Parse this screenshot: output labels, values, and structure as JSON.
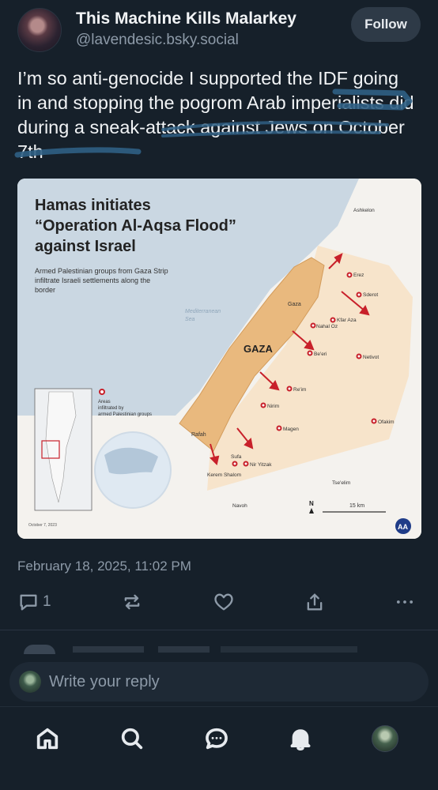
{
  "author": {
    "display_name": "This Machine Kills Malarkey",
    "handle": "@lavendesic.bsky.social",
    "avatar": "profile-avatar"
  },
  "follow_label": "Follow",
  "post": {
    "text": "I’m so anti-genocide I supported the IDF going in and stopping the pogrom Arab imperialists did during a sneak-attack against Jews on October 7th",
    "timestamp": "February 18, 2025, 11:02 PM"
  },
  "image": {
    "title_line1": "Hamas initiates",
    "title_line2": "“Operation Al-Aqsa Flood”",
    "title_line3": "against Israel",
    "subtitle_line1": "Armed Palestinian groups from Gaza Strip",
    "subtitle_line2": "infiltrate Israeli settlements along the",
    "subtitle_line3": "border",
    "sea_line1": "Mediterranean",
    "sea_line2": "Sea",
    "gaza_label": "GAZA",
    "gaza_city": "Gaza",
    "rafah": "Rafah",
    "legend_line1": "Areas",
    "legend_line2": "infiltrated by",
    "legend_line3": "armed Palestinian groups",
    "places": {
      "ashkelon": "Ashkelon",
      "erez": "Erez",
      "sderot": "Sderot",
      "kfar_aza": "Kfar Aza",
      "nahal_oz": "Nahal Oz",
      "beeri": "Be'eri",
      "netivot": "Netivot",
      "reim": "Re'im",
      "nirim": "Nirim",
      "ofakim": "Ofakim",
      "magen": "Magen",
      "sufa": "Sufa",
      "nir_yitzak": "Nir Yitzak",
      "kerem_shalom": "Kerem Shalom",
      "tseelim": "Tse'elim",
      "navoh": "Navoh"
    },
    "north": "N",
    "scale": "15 km",
    "date": "October 7, 2023",
    "agency_logo": "AA"
  },
  "actions": {
    "reply_count": "1",
    "reply_icon": "reply-icon",
    "repost_icon": "repost-icon",
    "like_icon": "heart-icon",
    "share_icon": "share-icon",
    "more_icon": "more-icon"
  },
  "reply_bar": {
    "placeholder": "Write your reply"
  },
  "nav": {
    "home": "home-icon",
    "search": "search-icon",
    "chat": "chat-icon",
    "notifications": "bell-icon",
    "profile": "profile-avatar"
  },
  "colors": {
    "background": "#16202a",
    "muted": "#8d9aa8",
    "gaza_fill": "#e9b97e",
    "border_zone": "#f7e2c6",
    "sea": "#c9d6e2",
    "arrow": "#c8202a"
  }
}
